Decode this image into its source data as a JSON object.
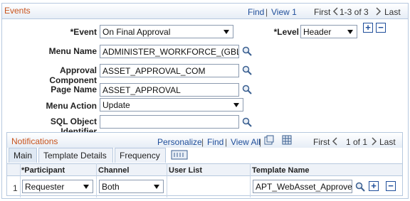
{
  "events": {
    "title": "Events",
    "nav": {
      "find": "Find",
      "sep1": "|",
      "view_all": "View 1",
      "first": "First",
      "range": "1-3 of 3",
      "last": "Last"
    },
    "event_label": "*Event",
    "event_value": "On Final Approval",
    "level_label": "*Level",
    "level_value": "Header",
    "menu_name_label": "Menu Name",
    "menu_name_value": "ADMINISTER_WORKFORCE_(GBL)",
    "approval_component_label": "Approval Component",
    "approval_component_value": "ASSET_APPROVAL_COM",
    "page_name_label": "Page Name",
    "page_name_value": "ASSET_APPROVAL",
    "menu_action_label": "Menu Action",
    "menu_action_value": "Update",
    "sql_object_label": "SQL Object Identifier",
    "sql_object_value": "",
    "add_symbol": "+",
    "remove_symbol": "−"
  },
  "notifications": {
    "title": "Notifications",
    "nav": {
      "personalize": "Personalize",
      "sep1": "|",
      "find": "Find",
      "sep2": "|",
      "view_all": "View All",
      "sep3": "|",
      "first": "First",
      "range": "1 of 1",
      "last": "Last"
    },
    "tabs": [
      {
        "label": "Main"
      },
      {
        "label": "Template Details"
      },
      {
        "label": "Frequency"
      }
    ],
    "columns": [
      "*Participant",
      "Channel",
      "User List",
      "Template Name"
    ],
    "rows": [
      {
        "num": "1",
        "participant": "Requester",
        "channel": "Both",
        "user_list": "",
        "template_name": "APT_WebAsset_Approved"
      }
    ],
    "add_symbol": "+",
    "remove_symbol": "−"
  },
  "colors": {
    "header_orange": "#c8531c",
    "link_blue": "#1f4e9a",
    "border": "#b7c9df"
  },
  "icons": [
    "search-icon",
    "add-icon",
    "remove-icon",
    "first-icon",
    "view-grid-icon",
    "download-icon",
    "show-all-columns-icon"
  ]
}
